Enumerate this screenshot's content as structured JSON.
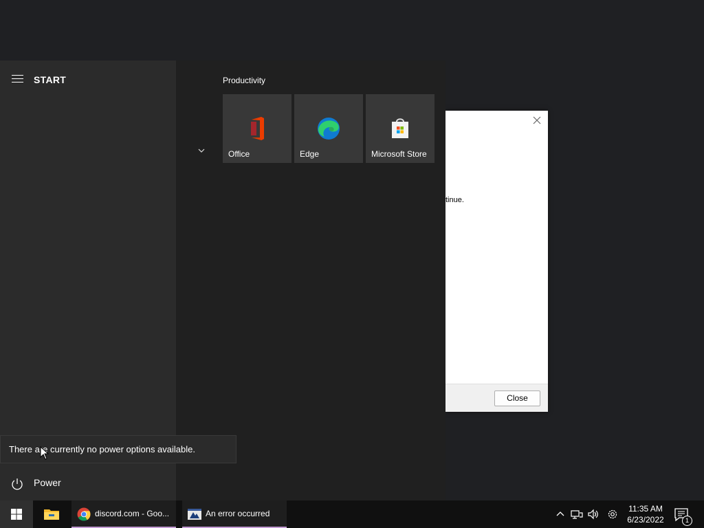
{
  "dialog": {
    "message_fragment": "tinue.",
    "close_button": "Close"
  },
  "start_menu": {
    "title": "START",
    "group_title": "Productivity",
    "tiles": [
      {
        "label": "Office",
        "icon": "office-icon"
      },
      {
        "label": "Edge",
        "icon": "edge-icon"
      },
      {
        "label": "Microsoft Store",
        "icon": "store-icon"
      }
    ],
    "power_label": "Power",
    "power_tooltip": "There are currently no power options available."
  },
  "taskbar": {
    "items": [
      {
        "label": "",
        "icon": "file-explorer-icon"
      },
      {
        "label": "discord.com - Goo...",
        "icon": "chrome-icon"
      },
      {
        "label": "An error occurred",
        "icon": "error-window-icon"
      }
    ],
    "clock_time": "11:35 AM",
    "clock_date": "6/23/2022",
    "notification_count": "1",
    "accent_color": "#c39bd3"
  }
}
